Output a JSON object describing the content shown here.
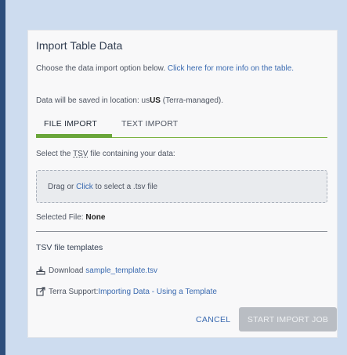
{
  "modal": {
    "title": "Import Table Data",
    "info_prefix": "Choose the data import option below. ",
    "info_link": "Click here for more info on the table.",
    "location_prefix": "Data will be saved in location: us",
    "location_value": "US",
    "location_suffix": " (Terra-managed).",
    "tabs": [
      {
        "label": "FILE IMPORT",
        "active": true
      },
      {
        "label": "TEXT IMPORT",
        "active": false
      }
    ],
    "select_prefix": "Select the ",
    "select_abbr": "TSV",
    "select_suffix": " file containing your data:",
    "dropzone_prefix": "Drag or ",
    "dropzone_link": "Click",
    "dropzone_suffix": " to select a .tsv file",
    "selected_label": "Selected File: ",
    "selected_value": "None",
    "templates_heading": "TSV file templates",
    "download_prefix": "Download ",
    "download_link": "sample_template.tsv",
    "support_prefix": "Terra Support: ",
    "support_link": "Importing Data - Using a Template",
    "cancel_label": "CANCEL",
    "start_label": "START IMPORT JOB"
  },
  "colors": {
    "accent": "#6aa63a",
    "link": "#3a6ab0",
    "disabled_button": "#b9bdc3"
  },
  "icons": {
    "download": "download-icon",
    "external_link": "external-link-icon"
  }
}
